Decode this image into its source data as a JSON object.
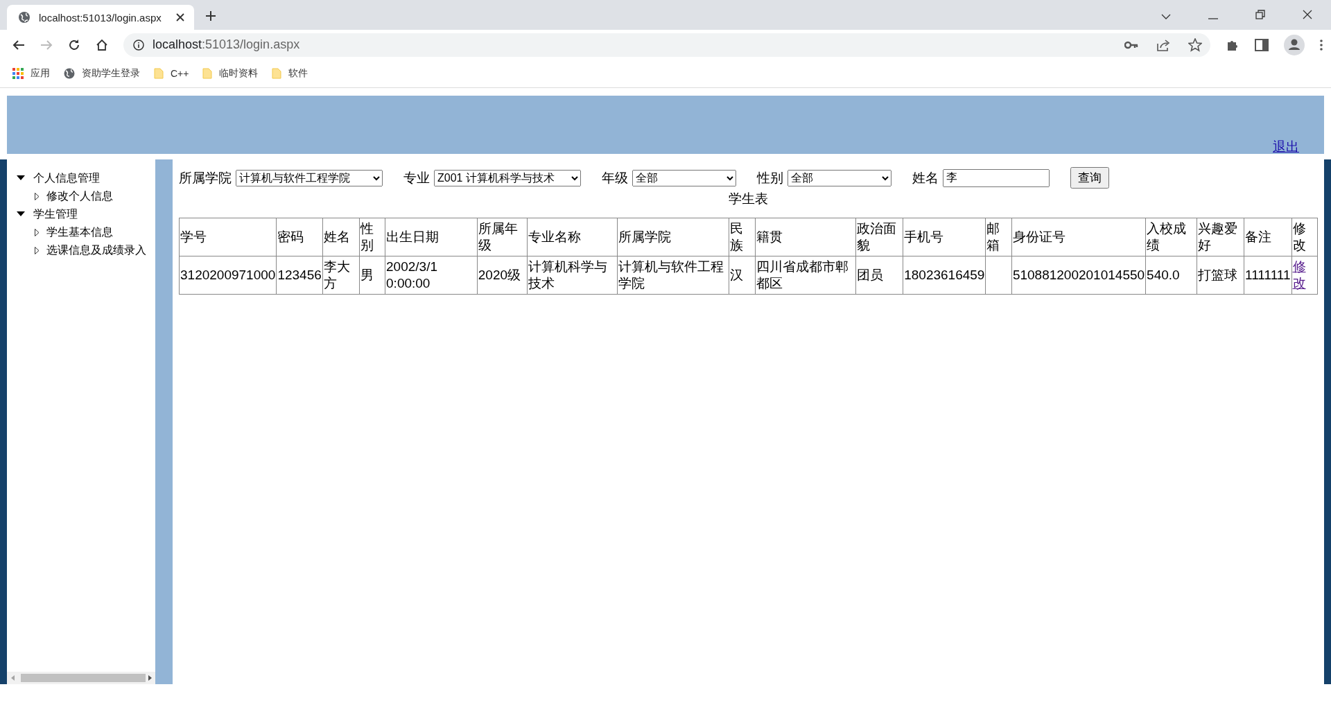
{
  "browser": {
    "tab": {
      "title": "localhost:51013/login.aspx",
      "selected": true
    },
    "address": {
      "host": "localhost",
      "rest": ":51013/login.aspx"
    },
    "bookmarks": [
      {
        "kind": "apps",
        "label": "应用"
      },
      {
        "kind": "site",
        "label": "资助学生登录"
      },
      {
        "kind": "folder",
        "label": "C++"
      },
      {
        "kind": "folder",
        "label": "临时资料"
      },
      {
        "kind": "folder",
        "label": "软件"
      }
    ]
  },
  "header": {
    "logout_link": "退出"
  },
  "sidebar": {
    "items": [
      {
        "label": "个人信息管理",
        "expanded": true,
        "children": [
          {
            "label": "修改个人信息",
            "expanded": false
          }
        ]
      },
      {
        "label": "学生管理",
        "expanded": true,
        "children": [
          {
            "label": "学生基本信息",
            "expanded": false
          },
          {
            "label": "选课信息及成绩录入",
            "expanded": false
          }
        ]
      }
    ]
  },
  "filters": [
    {
      "kind": "select",
      "label": "所属学院",
      "value": "计算机与软件工程学院"
    },
    {
      "kind": "select",
      "label": "专业",
      "value": "Z001 计算机科学与技术"
    },
    {
      "kind": "select",
      "label": "年级",
      "value": "全部"
    },
    {
      "kind": "select",
      "label": "性别",
      "value": "全部"
    },
    {
      "kind": "input",
      "label": "姓名",
      "value": "李"
    }
  ],
  "search_button": "查询",
  "table": {
    "title": "学生表",
    "columns": [
      "学号",
      "密码",
      "姓名",
      "性别",
      "出生日期",
      "所属年级",
      "专业名称",
      "所属学院",
      "民族",
      "籍贯",
      "政治面貌",
      "手机号",
      "邮箱",
      "身份证号",
      "入校成绩",
      "兴趣爱好",
      "备注",
      "修改"
    ],
    "rows": [
      {
        "cells": [
          "3120200971000",
          "123456",
          "李大方",
          "男",
          "2002/3/1 0:00:00",
          "2020级",
          "计算机科学与技术",
          "计算机与软件工程学院",
          "汉",
          "四川省成都市郫都区",
          "团员",
          "18023616459",
          "",
          "510881200201014550",
          "540.0",
          "打篮球",
          "1111111"
        ],
        "edit_link": "修改"
      }
    ]
  }
}
